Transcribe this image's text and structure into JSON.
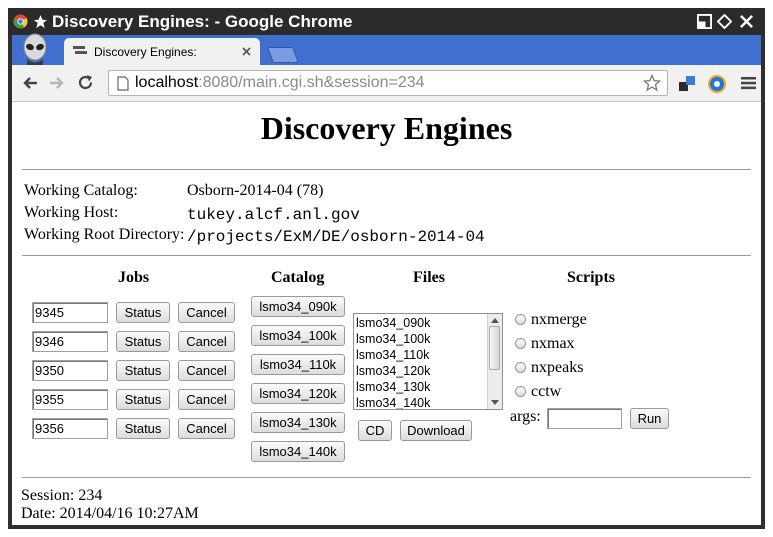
{
  "window": {
    "title": "Discovery Engines: - Google Chrome"
  },
  "tab": {
    "title": "Discovery Engines:"
  },
  "address": {
    "host": "localhost",
    "rest": ":8080/main.cgi.sh&session=234"
  },
  "page": {
    "heading": "Discovery Engines",
    "info": [
      {
        "label": "Working Catalog:",
        "value": "Osborn-2014-04 (78)"
      },
      {
        "label": "Working Host:",
        "value": "tukey.alcf.anl.gov"
      },
      {
        "label": "Working Root Directory:",
        "value": "/projects/ExM/DE/osborn-2014-04"
      }
    ],
    "jobs": {
      "header": "Jobs",
      "status_label": "Status",
      "cancel_label": "Cancel",
      "ids": [
        "9345",
        "9346",
        "9350",
        "9355",
        "9356"
      ]
    },
    "catalog": {
      "header": "Catalog",
      "items": [
        "lsmo34_090k",
        "lsmo34_100k",
        "lsmo34_110k",
        "lsmo34_120k",
        "lsmo34_130k",
        "lsmo34_140k"
      ]
    },
    "files": {
      "header": "Files",
      "items": [
        "lsmo34_090k",
        "lsmo34_100k",
        "lsmo34_110k",
        "lsmo34_120k",
        "lsmo34_130k",
        "lsmo34_140k"
      ],
      "cd_label": "CD",
      "download_label": "Download"
    },
    "scripts": {
      "header": "Scripts",
      "options": [
        "nxmerge",
        "nxmax",
        "nxpeaks",
        "cctw"
      ],
      "args_label": "args:",
      "args_value": "",
      "run_label": "Run"
    },
    "footer": {
      "session": "Session: 234",
      "date": "Date: 2014/04/16 10:27AM"
    }
  }
}
